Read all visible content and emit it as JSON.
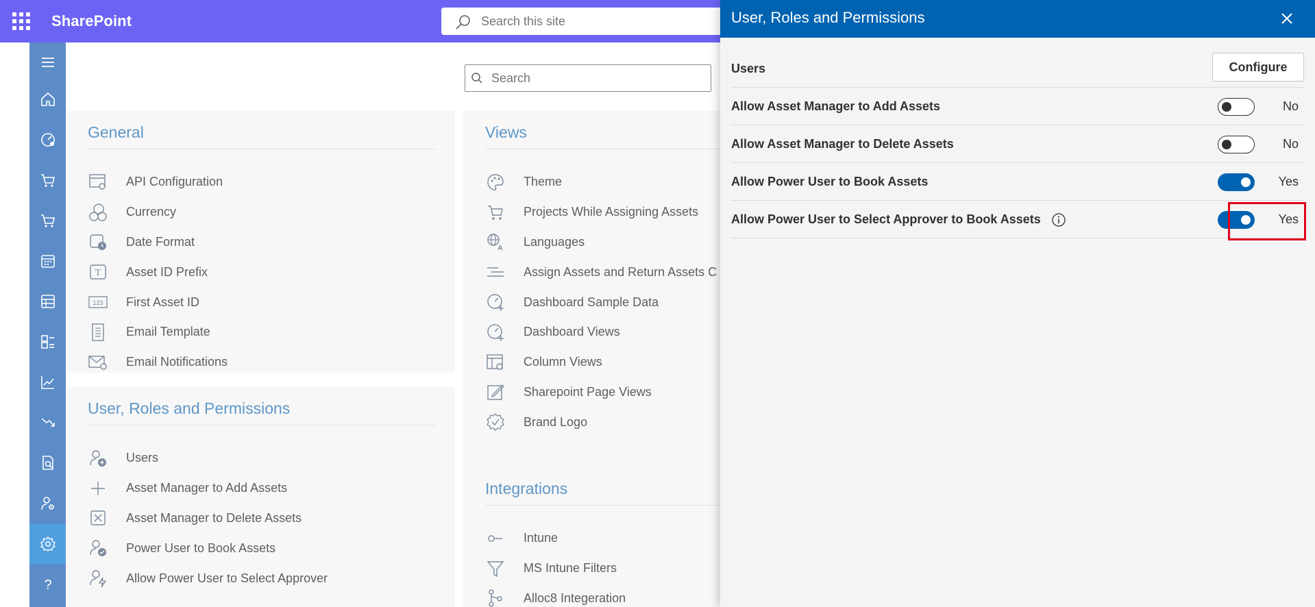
{
  "topbar": {
    "app_name": "SharePoint",
    "search_placeholder": "Search this site"
  },
  "rail": {
    "items": [
      "menu-icon",
      "home-icon",
      "dashboard-icon",
      "cart-icon",
      "cart-return-icon",
      "calendar-icon",
      "table-icon",
      "report-list-icon",
      "chart-up-icon",
      "chart-down-icon",
      "audit-icon",
      "user-settings-icon",
      "settings-icon",
      "help-icon"
    ],
    "active": "settings-icon"
  },
  "main": {
    "search_placeholder": "Search",
    "general": {
      "title": "General",
      "items": [
        {
          "label": "API Configuration",
          "icon": "api-config-icon"
        },
        {
          "label": "Currency",
          "icon": "currency-icon"
        },
        {
          "label": "Date Format",
          "icon": "date-format-icon"
        },
        {
          "label": "Asset ID Prefix",
          "icon": "text-prefix-icon"
        },
        {
          "label": "First Asset ID",
          "icon": "number-icon"
        },
        {
          "label": "Email Template",
          "icon": "document-icon"
        },
        {
          "label": "Email Notifications",
          "icon": "mail-settings-icon"
        }
      ]
    },
    "urp": {
      "title": "User, Roles and Permissions",
      "items": [
        {
          "label": "Users",
          "icon": "add-user-icon"
        },
        {
          "label": "Asset Manager to Add Assets",
          "icon": "plus-icon"
        },
        {
          "label": "Asset Manager to Delete Assets",
          "icon": "delete-box-icon"
        },
        {
          "label": "Power User to Book Assets",
          "icon": "user-check-icon"
        },
        {
          "label": "Allow Power User to Select Approver",
          "icon": "user-approver-icon"
        }
      ]
    },
    "views": {
      "title": "Views",
      "items": [
        {
          "label": "Theme",
          "icon": "palette-icon"
        },
        {
          "label": "Projects While Assigning Assets",
          "icon": "cart-icon"
        },
        {
          "label": "Languages",
          "icon": "globe-language-icon"
        },
        {
          "label": "Assign Assets and Return Assets C",
          "icon": "lines-icon"
        },
        {
          "label": "Dashboard Sample Data",
          "icon": "gauge-plus-icon"
        },
        {
          "label": "Dashboard Views",
          "icon": "gauge-plus-icon"
        },
        {
          "label": "Column Views",
          "icon": "column-settings-icon"
        },
        {
          "label": "Sharepoint Page Views",
          "icon": "edit-page-icon"
        },
        {
          "label": "Brand Logo",
          "icon": "badge-check-icon"
        }
      ]
    },
    "integrations": {
      "title": "Integrations",
      "items": [
        {
          "label": "Intune",
          "icon": "intune-icon"
        },
        {
          "label": "MS Intune Filters",
          "icon": "filter-icon"
        },
        {
          "label": "Alloc8 Integeration",
          "icon": "flow-icon"
        }
      ]
    }
  },
  "panel": {
    "title": "User, Roles and Permissions",
    "users_label": "Users",
    "configure_label": "Configure",
    "settings": [
      {
        "label": "Allow Asset Manager to Add Assets",
        "value": "No",
        "on": false
      },
      {
        "label": "Allow Asset Manager to Delete Assets",
        "value": "No",
        "on": false
      },
      {
        "label": "Allow Power User to Book Assets",
        "value": "Yes",
        "on": true
      },
      {
        "label": "Allow Power User to Select Approver to Book Assets",
        "value": "Yes",
        "on": true,
        "info": true
      }
    ],
    "highlight_color": "#e0001b"
  }
}
